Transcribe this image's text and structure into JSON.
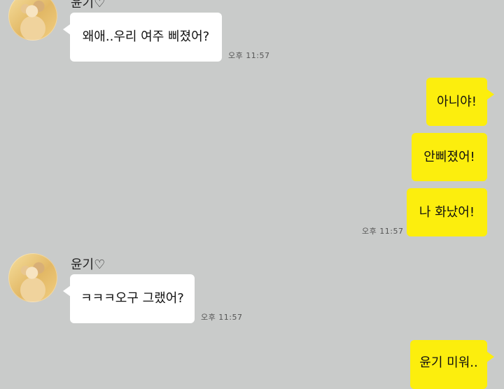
{
  "chat": {
    "sender_name": "윤기♡",
    "messages": [
      {
        "from": "left",
        "text": "왜애..우리 여주 삐졌어?",
        "time": "오후 11:57"
      },
      {
        "from": "right",
        "text": "아니야!"
      },
      {
        "from": "right",
        "text": "안삐졌어!"
      },
      {
        "from": "right",
        "text": "나 화났어!",
        "time": "오후 11:57"
      },
      {
        "from": "left",
        "text": "ㅋㅋㅋ오구 그랬어?",
        "time": "오후 11:57"
      },
      {
        "from": "right",
        "text": "윤기 미워.."
      }
    ]
  },
  "colors": {
    "background": "#c9cbca",
    "incoming_bubble": "#ffffff",
    "outgoing_bubble": "#fcee0d"
  }
}
